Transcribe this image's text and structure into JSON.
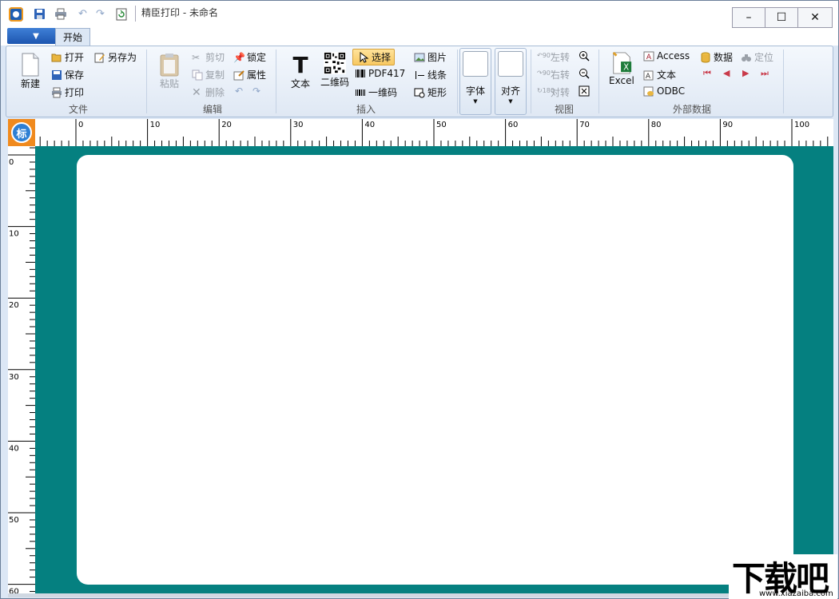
{
  "window": {
    "title": "精臣打印 - 未命名",
    "controls": {
      "minimize": "–",
      "maximize": "☐",
      "close": "✕"
    }
  },
  "tabs": [
    {
      "label": "开始"
    }
  ],
  "ribbon": {
    "file": {
      "label": "文件",
      "new": "新建",
      "open": "打开",
      "save_as": "另存为",
      "save": "保存",
      "print": "打印"
    },
    "edit": {
      "label": "编辑",
      "paste": "粘贴",
      "cut": "剪切",
      "copy": "复制",
      "delete": "删除",
      "lock": "锁定",
      "properties": "属性"
    },
    "insert": {
      "label": "插入",
      "text": "文本",
      "qrcode": "二维码",
      "select": "选择",
      "pdf417": "PDF417",
      "barcode": "一维码",
      "image": "图片",
      "line": "线条",
      "rect": "矩形"
    },
    "font": {
      "label": "字体"
    },
    "align": {
      "label": "对齐"
    },
    "view": {
      "label": "视图",
      "rotate_left": "左转",
      "rotate_right": "右转",
      "rotate_180": "对转"
    },
    "external": {
      "label": "外部数据",
      "excel": "Excel",
      "access": "Access",
      "text": "文本",
      "odbc": "ODBC",
      "data": "数据",
      "locate": "定位"
    }
  },
  "ruler": {
    "corner": "标",
    "h_labels": [
      "0",
      "10",
      "20",
      "30",
      "40",
      "50",
      "60",
      "70",
      "80",
      "90",
      "100"
    ],
    "v_labels": [
      "0",
      "10",
      "20",
      "30",
      "40",
      "50",
      "60"
    ]
  },
  "watermark": {
    "logo": "下载吧",
    "site": "www.xiazaiba.com"
  }
}
